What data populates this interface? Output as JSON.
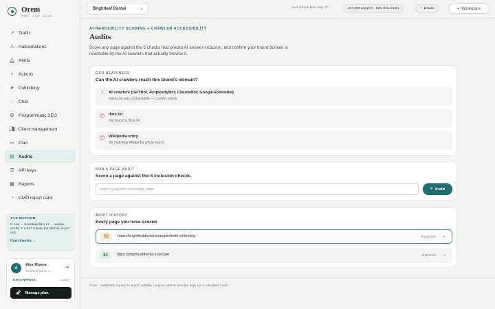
{
  "brand": {
    "name": "Orem",
    "subtitle": "GEO · AAO · AIHO"
  },
  "sidebar": {
    "items": [
      {
        "label": "Traffic",
        "icon": "↗"
      },
      {
        "label": "Hallucinations",
        "icon": "⚠"
      },
      {
        "label": "Alerts",
        "icon": "🔔︎"
      },
      {
        "label": "Actions",
        "icon": "⚡︎"
      },
      {
        "label": "Publishing",
        "icon": "➤"
      },
      {
        "label": "Chat",
        "icon": "◌"
      },
      {
        "label": "Programmatic SEO",
        "icon": "⚙"
      },
      {
        "label": "Client management",
        "icon": "👥︎"
      },
      {
        "label": "Plan",
        "icon": "▭"
      },
      {
        "label": "Audits",
        "icon": "▤"
      },
      {
        "label": "API keys",
        "icon": "⚿"
      },
      {
        "label": "Reports",
        "icon": "▦"
      },
      {
        "label": "CMO report card",
        "icon": "◔"
      }
    ],
    "active_index": 9
  },
  "method": {
    "title": "THE METHOD",
    "text": "N runs → bootstrap 95% CI → overlap verdict. If it isn't outside the interval, it isn't real.",
    "link": "How it works →"
  },
  "user": {
    "initial": "A",
    "name": "Alex Rivera",
    "org": "Brightleaf Demo A...",
    "tier": "ENTERPRISE",
    "plan_type": "custom",
    "manage_label": "Manage plan"
  },
  "topbar": {
    "brand_selected": "Brightleaf Dental",
    "refresh": "next refresh Mon Sep 23",
    "samples": "287,509 samples · 58% this month",
    "details_label": "Details",
    "workspace_label": "Workspace"
  },
  "header": {
    "eyebrow": "AI-READABILITY SCORING + CRAWLER ACCESSIBILITY",
    "title": "Audits",
    "description": "Score any page against the 6 checks that predict AI answer inclusion, and confirm your brand domain is reachable by the AI crawlers that actually browse it."
  },
  "geo": {
    "eyebrow": "GEO READINESS",
    "title": "Can the AI crawlers reach this brand's domain?",
    "checks": [
      {
        "status_icon": "?",
        "title": "AI crawlers (GPTBot, PerplexityBot, ClaudeBot, Google-Extended)",
        "detail": "robots.txt was unreachable — couldn't check."
      },
      {
        "status_icon": "×",
        "title": "llms.txt",
        "detail": "Not found at /llms.txt."
      },
      {
        "status_icon": "×",
        "title": "Wikipedia entry",
        "detail": "No matching Wikipedia article found."
      }
    ]
  },
  "audit": {
    "eyebrow": "RUN A PAGE AUDIT",
    "title": "Score a page against the 6 inclusion checks",
    "placeholder": "https://yoursite.com/some-page",
    "button": "Audit"
  },
  "history": {
    "eyebrow": "AUDIT HISTORY",
    "title": "Every page you have scored",
    "rows": [
      {
        "score": "50",
        "url": "https://brightleafdental.example/teeth-whitening",
        "date": "9/18/2026"
      },
      {
        "score": "83",
        "url": "https://brightleafdental.example/",
        "date": "9/18/2026"
      }
    ]
  },
  "footer": "Orem · statistically honest AI-search visibility · engines without provider keys run in simulated mode"
}
